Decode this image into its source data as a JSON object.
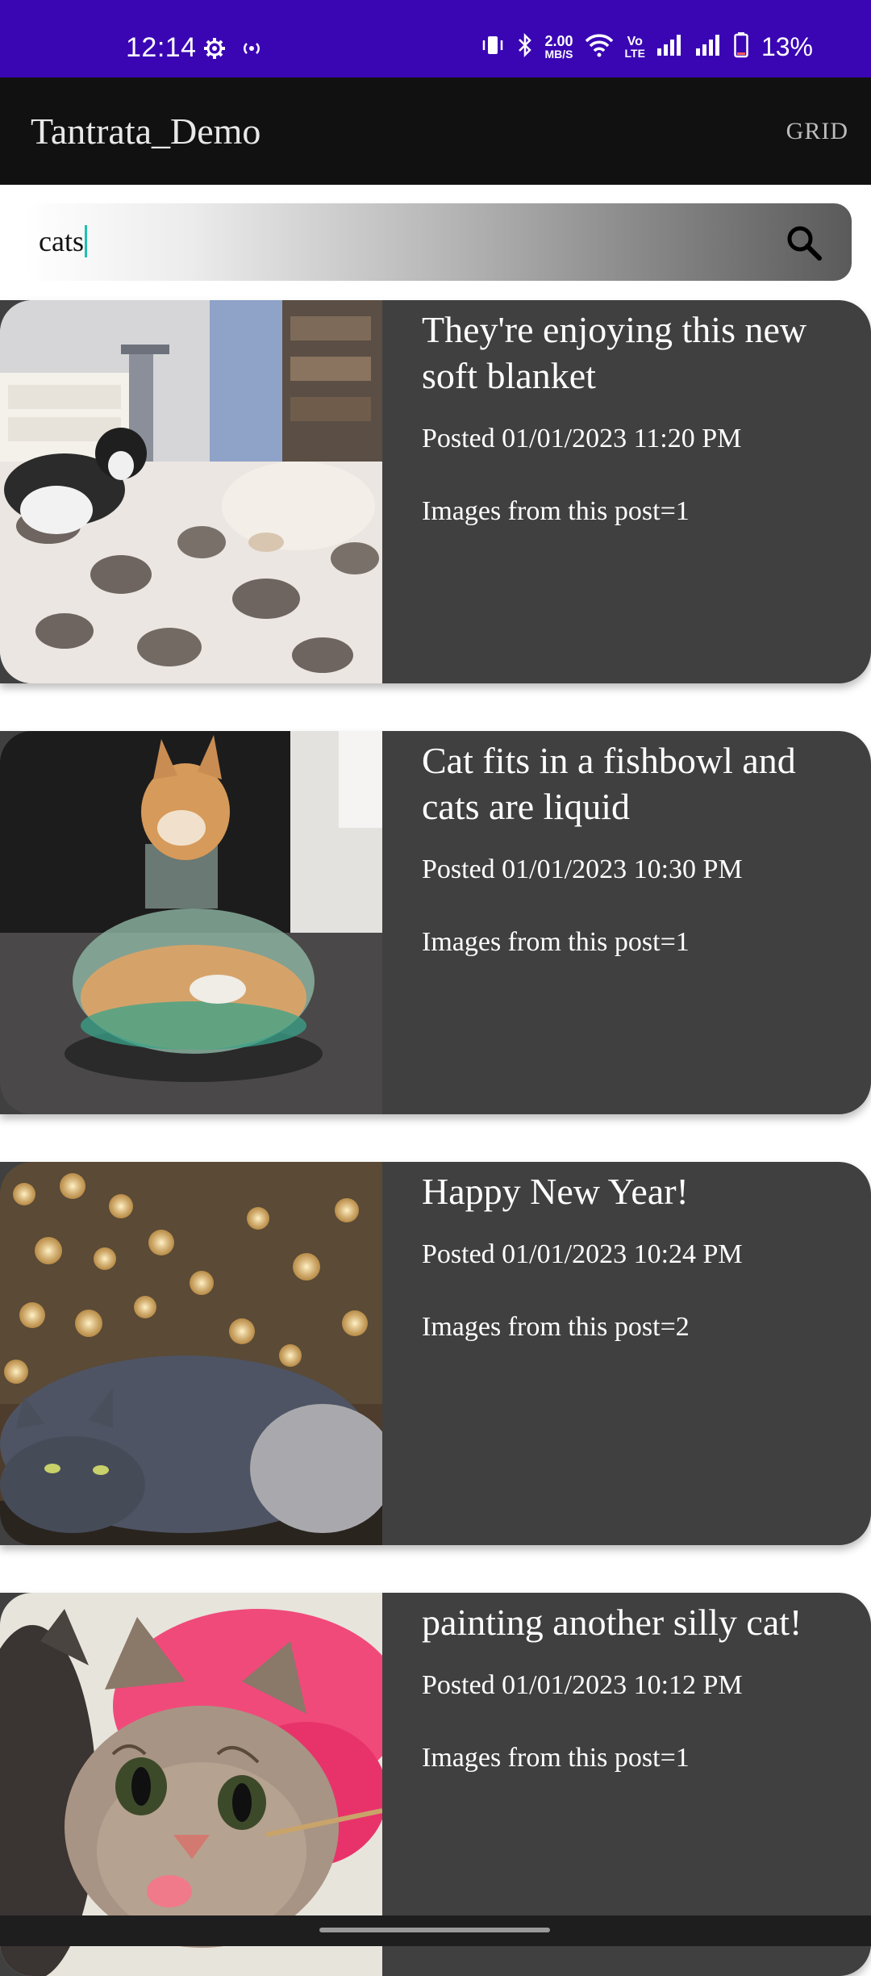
{
  "status_bar": {
    "time": "12:14",
    "speed_value": "2.00",
    "speed_unit": "MB/S",
    "volte_top": "Vo",
    "volte_bottom": "LTE",
    "battery": "13%",
    "background": "#3a06b4",
    "icons": [
      "settings-icon",
      "hotspot-icon",
      "vibrate-icon",
      "bluetooth-icon",
      "wifi-icon",
      "signal-icon",
      "signal-icon",
      "battery-icon"
    ]
  },
  "app_bar": {
    "title": "Tantrata_Demo",
    "action": "GRID",
    "background": "#111111"
  },
  "search": {
    "value": "cats",
    "icon": "search-icon"
  },
  "posts": [
    {
      "title": "They're enjoying this new soft blanket",
      "posted": "Posted 01/01/2023 11:20 PM",
      "images": "Images from this post=1",
      "image": "cats-on-leopard-blanket"
    },
    {
      "title": "Cat fits in a fishbowl and cats are liquid",
      "posted": "Posted 01/01/2023 10:30 PM",
      "images": "Images from this post=1",
      "image": "cat-in-fishbowl"
    },
    {
      "title": "Happy New Year!",
      "posted": "Posted 01/01/2023 10:24 PM",
      "images": "Images from this post=2",
      "image": "grey-cat-bokeh-lights"
    },
    {
      "title": "painting another silly cat!",
      "posted": "Posted 01/01/2023 10:12 PM",
      "images": "Images from this post=1",
      "image": "painted-cat"
    }
  ],
  "colors": {
    "card_background": "#404040",
    "caret": "#20c0b0"
  }
}
